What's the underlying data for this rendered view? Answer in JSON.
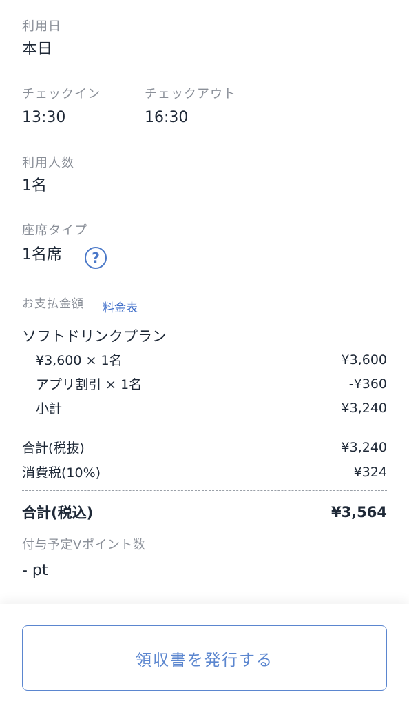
{
  "usage_date": {
    "label": "利用日",
    "value": "本日"
  },
  "checkin": {
    "label": "チェックイン",
    "value": "13:30"
  },
  "checkout": {
    "label": "チェックアウト",
    "value": "16:30"
  },
  "people": {
    "label": "利用人数",
    "value": "1名"
  },
  "seat": {
    "label": "座席タイプ",
    "value": "1名席",
    "help_icon": "?"
  },
  "payment": {
    "label": "お支払金額",
    "price_table_link": "料金表",
    "plan_name": "ソフトドリンクプラン",
    "lines": [
      {
        "name": "¥3,600 × 1名",
        "amount": "¥3,600"
      },
      {
        "name": "アプリ割引 × 1名",
        "amount": "-¥360"
      },
      {
        "name": "小計",
        "amount": "¥3,240"
      }
    ],
    "subtotal_ex_tax": {
      "name": "合計(税抜)",
      "amount": "¥3,240"
    },
    "tax": {
      "name": "消費税(10%)",
      "amount": "¥324"
    },
    "total_in_tax": {
      "name": "合計(税込)",
      "amount": "¥3,564"
    }
  },
  "points": {
    "label": "付与予定Vポイント数",
    "value": "- pt"
  },
  "receipt_button": {
    "label": "領収書を発行する"
  },
  "colors": {
    "accent": "#4a78c8",
    "label_gray": "#8a8f98",
    "text": "#1f2937"
  }
}
